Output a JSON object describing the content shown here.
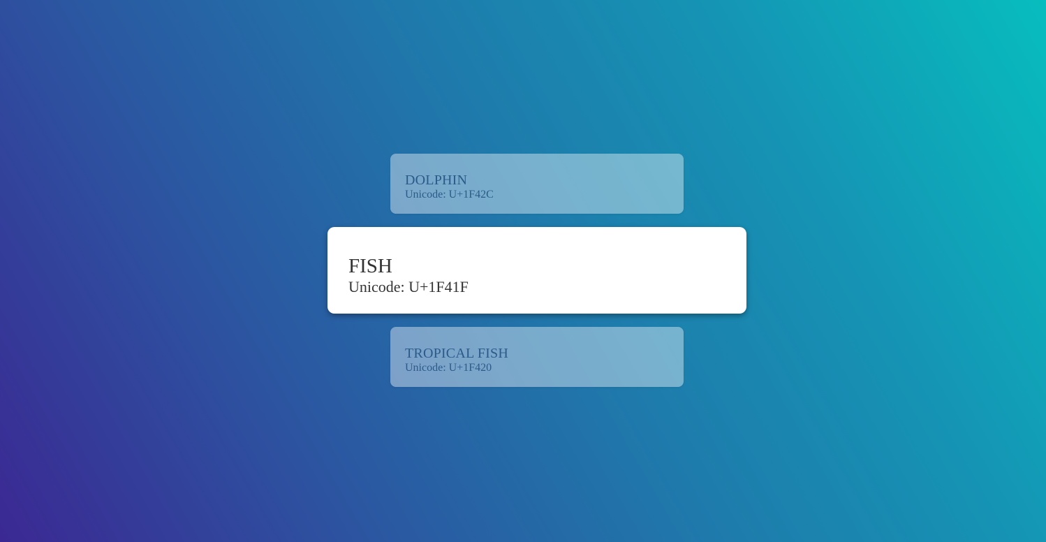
{
  "cards": {
    "previous": {
      "name": "DOLPHIN",
      "code": "Unicode: U+1F42C"
    },
    "current": {
      "name": "FISH",
      "code": "Unicode: U+1F41F"
    },
    "next": {
      "name": "TROPICAL FISH",
      "code": "Unicode: U+1F420"
    }
  },
  "colors": {
    "gradient_start": "#3b2893",
    "gradient_mid": "#1f79ab",
    "gradient_end": "#07bdbe",
    "card_text": "#333333",
    "side_card_text": "#2b5a8a"
  }
}
